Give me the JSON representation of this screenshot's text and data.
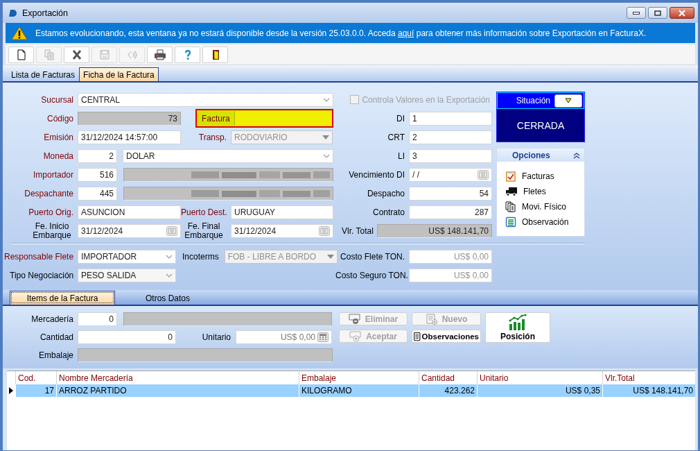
{
  "window": {
    "title": "Exportación"
  },
  "banner": {
    "text_before": "Estamos evolucionando, esta ventana ya no estará disponible desde la versión 25.03.0.0. Acceda ",
    "link": "aquí",
    "text_after": " para obtener más información sobre Exportación en FacturaX."
  },
  "toolbar": [
    {
      "kind": "new",
      "disabled": false
    },
    {
      "kind": "copy",
      "disabled": true
    },
    {
      "kind": "delete",
      "disabled": false
    },
    {
      "kind": "save",
      "disabled": true
    },
    {
      "kind": "undo",
      "disabled": true
    },
    {
      "kind": "print",
      "disabled": false
    },
    {
      "kind": "help",
      "disabled": false
    },
    {
      "kind": "exit",
      "disabled": false
    }
  ],
  "tabs": [
    {
      "label": "Lista de Facturas",
      "selected": false
    },
    {
      "label": "Ficha de la Factura",
      "selected": true
    }
  ],
  "form": {
    "sucursal": {
      "label": "Sucursal",
      "required": true,
      "kind": "select",
      "value": "CENTRAL",
      "disabled": false
    },
    "codigo": {
      "label": "Código",
      "required": true,
      "kind": "display",
      "value": "73"
    },
    "factura": {
      "label": "Factura",
      "required": true,
      "highlighted": true
    },
    "emision": {
      "label": "Emisión",
      "required": true,
      "kind": "text",
      "value": "31/12/2024 14:57:00"
    },
    "transp": {
      "label": "Transp.",
      "required": true,
      "kind": "select",
      "value": "RODOVIARIO",
      "disabled": true
    },
    "moneda": {
      "label": "Moneda",
      "required": true,
      "code": {
        "kind": "number",
        "value": "2"
      },
      "name": {
        "kind": "select",
        "value": "DOLAR",
        "disabled": false
      }
    },
    "importador": {
      "label": "Importador",
      "required": true,
      "code": {
        "kind": "number",
        "value": "516"
      },
      "name": {
        "kind": "redacted"
      }
    },
    "despachante": {
      "label": "Despachante",
      "required": true,
      "code": {
        "kind": "number",
        "value": "445"
      },
      "name": {
        "kind": "redacted"
      }
    },
    "puerto_orig": {
      "label": "Puerto Orig.",
      "required": true,
      "kind": "text",
      "value": "ASUNCION"
    },
    "puerto_dest": {
      "label": "Puerto Dest.",
      "required": true,
      "kind": "text",
      "value": "URUGUAY"
    },
    "fe_inicio": {
      "label": "Fe. Inicio Embarque",
      "required": false,
      "kind": "date",
      "value": "31/12/2024"
    },
    "fe_final": {
      "label": "Fe. Final Embarque",
      "required": false,
      "kind": "date",
      "value": "31/12/2024"
    },
    "controla": {
      "label": "Controla Valores en la Exportación",
      "checked": false,
      "disabled": true
    },
    "di": {
      "label": "DI",
      "required": false,
      "kind": "text",
      "value": "1"
    },
    "crt": {
      "label": "CRT",
      "required": false,
      "kind": "text",
      "value": "2"
    },
    "li": {
      "label": "LI",
      "required": false,
      "kind": "text",
      "value": "3"
    },
    "vencimiento_di": {
      "label": "Vencimiento DI",
      "required": false,
      "kind": "date",
      "value": "/ /"
    },
    "despacho": {
      "label": "Despacho",
      "required": false,
      "kind": "number",
      "value": "54"
    },
    "contrato": {
      "label": "Contrato",
      "required": false,
      "kind": "number",
      "value": "287"
    },
    "vlr_total": {
      "label": "Vlr. Total",
      "required": false,
      "kind": "display",
      "value": "US$ 148.141,70"
    },
    "responsable_flete": {
      "label": "Responsable Flete",
      "required": true,
      "kind": "select",
      "value": "IMPORTADOR",
      "disabled": false
    },
    "incoterms": {
      "label": "Incoterms",
      "required": false,
      "kind": "select",
      "value": "FOB - LIBRE A BORDO",
      "disabled": true
    },
    "tipo_negociacion": {
      "label": "Tipo Negociación",
      "required": false,
      "kind": "select",
      "value": "PESO SALIDA",
      "disabled": false
    },
    "costo_flete": {
      "label": "Costo Flete TON.",
      "required": false,
      "kind": "number",
      "value": "US$ 0,00",
      "disabled": true
    },
    "costo_seguro": {
      "label": "Costo Seguro TON.",
      "required": false,
      "kind": "number",
      "value": "US$ 0,00",
      "disabled": true
    }
  },
  "situacion": {
    "label": "Situación",
    "value": "CERRADA"
  },
  "opciones": {
    "title": "Opciones",
    "expanded": true,
    "items": [
      {
        "kind": "facturas",
        "label": "Facturas"
      },
      {
        "kind": "fletes",
        "label": "Fletes"
      },
      {
        "kind": "movimiento",
        "label": "Movi. Físico"
      },
      {
        "kind": "observacion",
        "label": "Observación"
      }
    ]
  },
  "subtabs": [
    {
      "label": "Items de la Factura",
      "selected": true
    },
    {
      "label": "Otros Datos",
      "selected": false
    }
  ],
  "items_form": {
    "mercaderia": {
      "label": "Mercadería",
      "required": false,
      "code": {
        "kind": "number",
        "value": "0"
      },
      "name": {
        "kind": "display"
      }
    },
    "cantidad": {
      "label": "Cantidad",
      "required": false,
      "kind": "number",
      "value": "0"
    },
    "unitario": {
      "label": "Unitario",
      "required": false,
      "kind": "calc",
      "value": "US$ 0,00"
    },
    "embalaje": {
      "label": "Embalaje",
      "required": false,
      "kind": "display"
    }
  },
  "buttons": [
    {
      "kind": "eliminar",
      "label": "Eliminar",
      "disabled": true
    },
    {
      "kind": "nuevo",
      "label": "Nuevo",
      "disabled": true
    },
    {
      "kind": "aceptar",
      "label": "Aceptar",
      "disabled": true
    },
    {
      "kind": "observaciones",
      "label": "Observaciones",
      "disabled": false
    }
  ],
  "position_button": {
    "kind": "posicion",
    "label": "Posición",
    "disabled": false
  },
  "table": {
    "columns": [
      "Cod.",
      "Nombre Mercadería",
      "Embalaje",
      "Cantidad",
      "Unitario",
      "Vlr.Total"
    ],
    "rows": [
      {
        "selected": true,
        "cells": [
          "17",
          "ARROZ PARTIDO",
          "KILOGRAMO",
          "423.262",
          "US$ 0,35",
          "US$ 148.141,70"
        ]
      }
    ]
  }
}
